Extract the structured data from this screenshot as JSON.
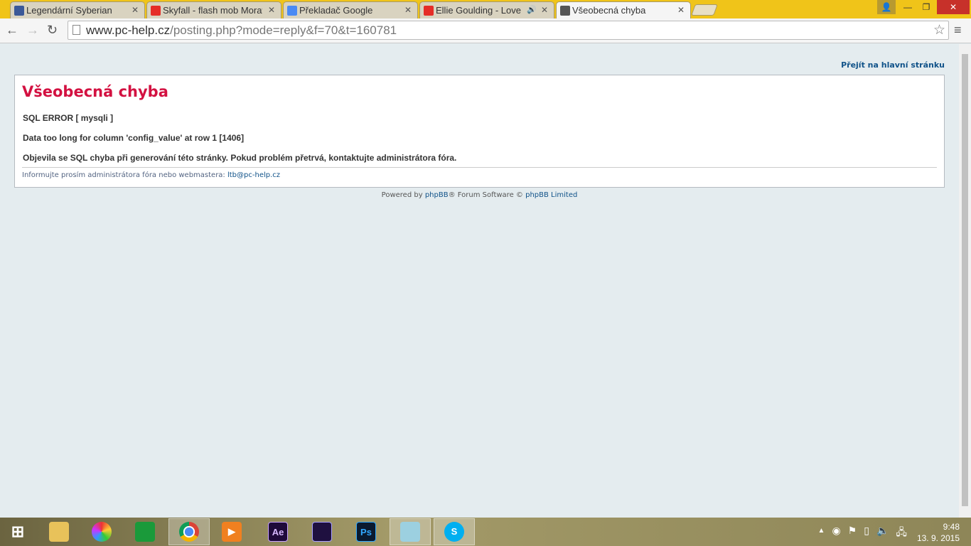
{
  "browser": {
    "tabs": [
      {
        "title": "Legendární Syberian",
        "icon": "facebook-icon",
        "color": "#3b5998"
      },
      {
        "title": "Skyfall - flash mob Morav",
        "icon": "youtube-icon",
        "color": "#e52d27"
      },
      {
        "title": "Překladač Google",
        "icon": "google-translate-icon",
        "color": "#4a8af4"
      },
      {
        "title": "Ellie Goulding - Love M",
        "icon": "youtube-icon",
        "color": "#e52d27"
      },
      {
        "title": "Všeobecná chyba",
        "icon": "computer-icon",
        "color": "#555"
      }
    ],
    "url_host": "www.pc-help.cz",
    "url_path": "/posting.php?mode=reply&f=70&t=160781"
  },
  "page": {
    "home_link": "Přejít na hlavní stránku",
    "title": "Všeobecná chyba",
    "sql_error": "SQL ERROR [ mysqli ]",
    "detail": "Data too long for column 'config_value' at row 1 [1406]",
    "message": "Objevila se SQL chyba při generování této stránky. Pokud problém přetrvá, kontaktujte administrátora fóra.",
    "info_prefix": "Informujte prosím administrátora fóra nebo webmastera: ",
    "info_email": "ltb@pc-help.cz",
    "powered_prefix": "Powered by ",
    "powered_link": "phpBB",
    "powered_mid": "® Forum Software © ",
    "powered_link2": "phpBB Limited"
  },
  "taskbar": {
    "apps": [
      "start",
      "file-explorer",
      "picasa",
      "store",
      "chrome",
      "media-player",
      "after-effects",
      "media-encoder",
      "photoshop",
      "notepad",
      "skype"
    ],
    "ae": "Ae",
    "ps": "Ps",
    "time": "9:48",
    "date": "13. 9. 2015"
  }
}
